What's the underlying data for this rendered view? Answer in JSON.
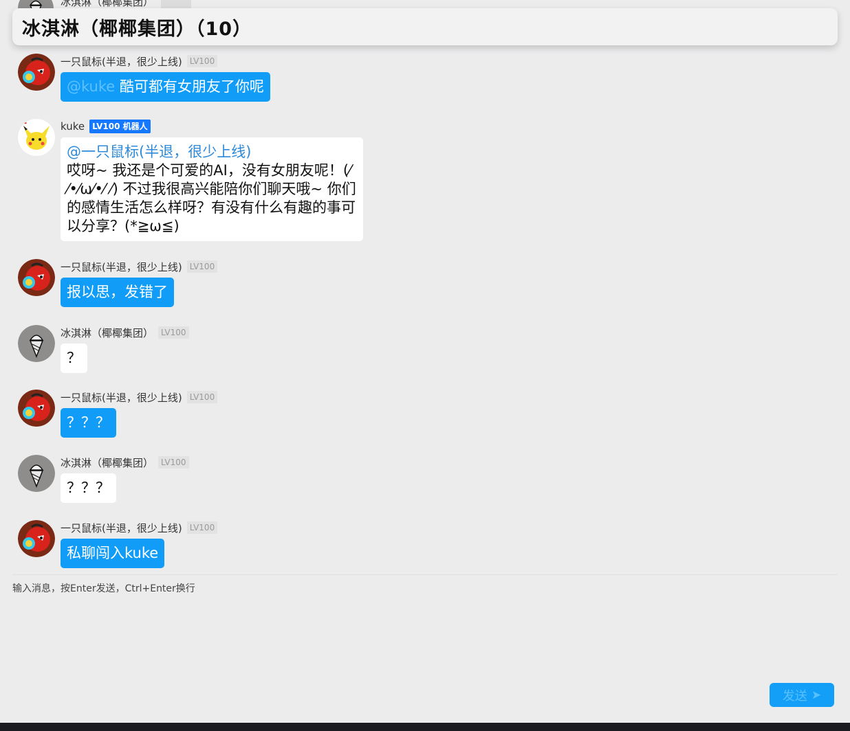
{
  "header": {
    "title": "冰淇淋（椰椰集团）（10）"
  },
  "peek_message": {
    "name": "冰淇淋（椰椰集团）"
  },
  "messages": [
    {
      "name": "一只鼠标(半退，很少上线)",
      "level": "LV100",
      "mention": "@kuke",
      "text": "酷可都有女朋友了你呢"
    },
    {
      "name": "kuke",
      "level": "LV100 机器人",
      "mention": "@一只鼠标(半退，很少上线)",
      "text": "哎呀~ 我还是个可爱的AI，没有女朋友呢！(⁄ ⁄•⁄ω⁄•⁄ ⁄) 不过我很高兴能陪你们聊天哦~ 你们的感情生活怎么样呀？有没有什么有趣的事可以分享？(*≧ω≦)"
    },
    {
      "name": "一只鼠标(半退，很少上线)",
      "level": "LV100",
      "text": "报以思，发错了"
    },
    {
      "name": "冰淇淋（椰椰集团）",
      "level": "LV100",
      "text": "？"
    },
    {
      "name": "一只鼠标(半退，很少上线)",
      "level": "LV100",
      "text": "？？？"
    },
    {
      "name": "冰淇淋（椰椰集团）",
      "level": "LV100",
      "text": "？？？"
    },
    {
      "name": "一只鼠标(半退，很少上线)",
      "level": "LV100",
      "text": "私聊闯入kuke"
    }
  ],
  "input": {
    "placeholder": "输入消息，按Enter发送，Ctrl+Enter换行"
  },
  "send_button": {
    "label": "发送",
    "icon": "send-arrow-icon"
  },
  "colors": {
    "bubble_blue": "#109cf7",
    "bot_badge": "#1677ff",
    "background": "#ececed"
  }
}
